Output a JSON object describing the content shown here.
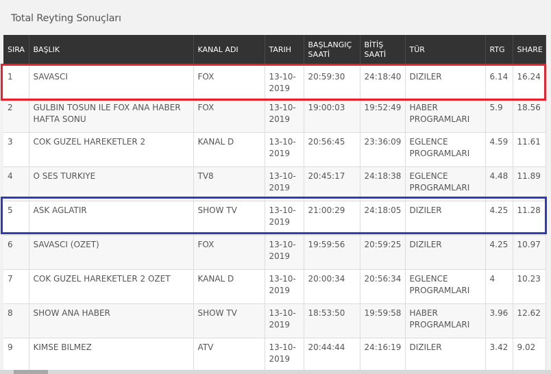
{
  "title": "Total Reyting Sonuçları",
  "columns": [
    "SIRA",
    "BAŞLIK",
    "KANAL ADI",
    "TARIH",
    "BAŞLANGIÇ SAATİ",
    "BİTİŞ SAATİ",
    "TÜR",
    "RTG",
    "SHARE"
  ],
  "rows": [
    [
      "1",
      "SAVASCI",
      "FOX",
      "13-10-2019",
      "20:59:30",
      "24:18:40",
      "DIZILER",
      "6.14",
      "16.24"
    ],
    [
      "2",
      "GULBIN TOSUN ILE FOX ANA HABER HAFTA SONU",
      "FOX",
      "13-10-2019",
      "19:00:03",
      "19:52:49",
      "HABER PROGRAMLARI",
      "5.9",
      "18.56"
    ],
    [
      "3",
      "COK GUZEL HAREKETLER 2",
      "KANAL D",
      "13-10-2019",
      "20:56:45",
      "23:36:09",
      "EGLENCE PROGRAMLARI",
      "4.59",
      "11.61"
    ],
    [
      "4",
      "O SES TURKIYE",
      "TV8",
      "13-10-2019",
      "20:45:17",
      "24:18:38",
      "EGLENCE PROGRAMLARI",
      "4.48",
      "11.89"
    ],
    [
      "5",
      "ASK AGLATIR",
      "SHOW TV",
      "13-10-2019",
      "21:00:29",
      "24:18:05",
      "DIZILER",
      "4.25",
      "11.28"
    ],
    [
      "6",
      "SAVASCI (OZET)",
      "FOX",
      "13-10-2019",
      "19:59:56",
      "20:59:25",
      "DIZILER",
      "4.25",
      "10.97"
    ],
    [
      "7",
      "COK GUZEL HAREKETLER 2 OZET",
      "KANAL D",
      "13-10-2019",
      "20:00:34",
      "20:56:34",
      "EGLENCE PROGRAMLARI",
      "4",
      "10.23"
    ],
    [
      "8",
      "SHOW ANA HABER",
      "SHOW TV",
      "13-10-2019",
      "18:53:50",
      "19:59:58",
      "HABER PROGRAMLARI",
      "3.96",
      "12.62"
    ],
    [
      "9",
      "KIMSE BILMEZ",
      "ATV",
      "13-10-2019",
      "20:44:44",
      "24:16:19",
      "DIZILER",
      "3.42",
      "9.02"
    ]
  ],
  "colors": {
    "header_bg": "#333333",
    "highlight_red": "#e8212b",
    "highlight_blue": "#2c3cbc"
  }
}
